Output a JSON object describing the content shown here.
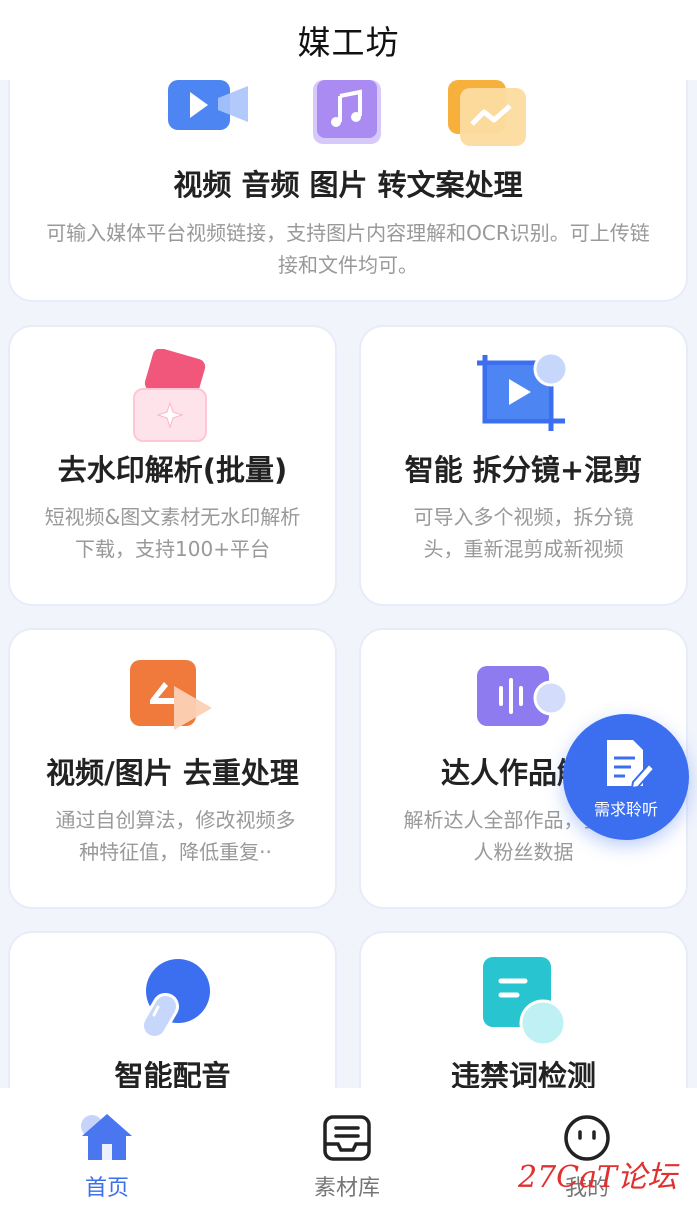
{
  "app": {
    "title": "媒工坊"
  },
  "cards": {
    "media_to_text": {
      "title": "视频 音频 图片 转文案处理",
      "desc": "可输入媒体平台视频链接，支持图片内容理解和OCR识别。可上传链接和文件均可。"
    },
    "watermark_removal": {
      "title": "去水印解析(批量)",
      "desc": "短视频&图文素材无水印解析下载，支持100+平台"
    },
    "split_remix": {
      "title": "智能 拆分镜+混剪",
      "desc": "可导入多个视频，拆分镜头，重新混剪成新视频"
    },
    "dedup": {
      "title": "视频/图片 去重处理",
      "desc": "通过自创算法，修改视频多种特征值，降低重复··"
    },
    "creator_parse": {
      "title": "达人作品解",
      "desc": "解析达人全部作品，查看达人粉丝数据"
    },
    "voiceover": {
      "title": "智能配音"
    },
    "banned_words": {
      "title": "违禁词检测"
    }
  },
  "fab": {
    "label": "需求聆听"
  },
  "bottom_nav": {
    "items": [
      {
        "label": "首页",
        "icon": "home-icon",
        "active": true
      },
      {
        "label": "素材库",
        "icon": "inbox-icon",
        "active": false
      },
      {
        "label": "我的",
        "icon": "face-icon",
        "active": false
      }
    ]
  },
  "watermark": {
    "text": "27CaT论坛"
  },
  "colors": {
    "accent": "#3c6ff0",
    "nav_inactive": "#777777",
    "desc": "#999999"
  }
}
